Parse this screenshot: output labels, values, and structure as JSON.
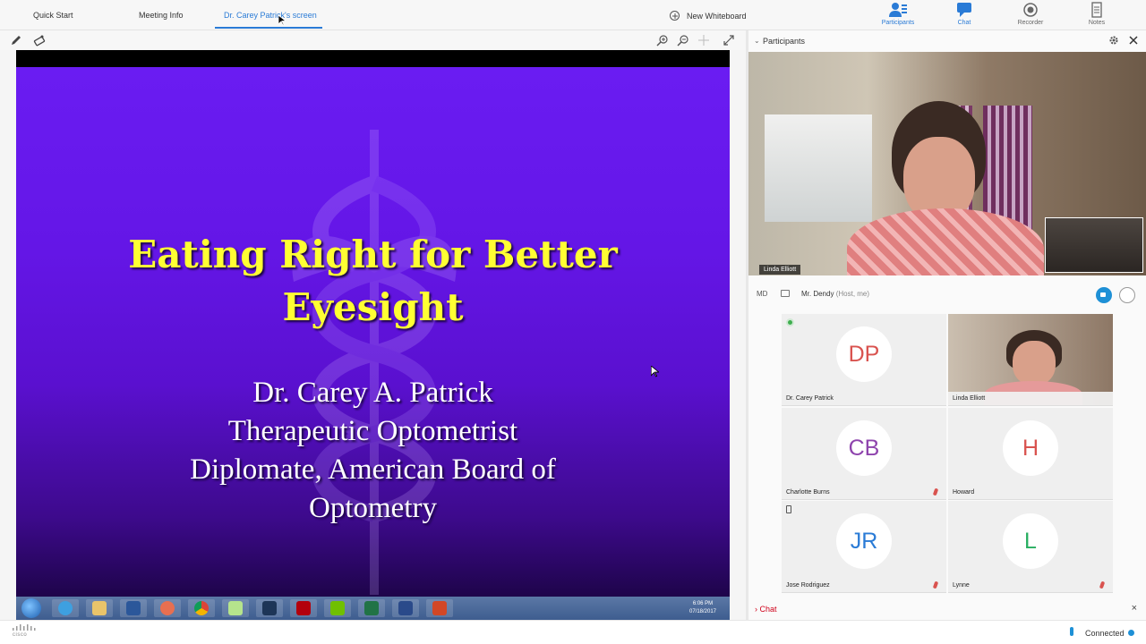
{
  "tabs": [
    {
      "label": "Quick Start"
    },
    {
      "label": "Meeting Info"
    },
    {
      "label": "Dr. Carey Patrick's screen"
    }
  ],
  "new_whiteboard": "New Whiteboard",
  "right_tools": [
    {
      "label": "Participants",
      "icon": "participants-icon",
      "active": true
    },
    {
      "label": "Chat",
      "icon": "chat-icon",
      "active": false
    },
    {
      "label": "Recorder",
      "icon": "recorder-icon",
      "active": false
    },
    {
      "label": "Notes",
      "icon": "notes-icon",
      "active": false
    }
  ],
  "slide": {
    "title_line1": "Eating Right for Better",
    "title_line2": "Eyesight",
    "sub_line1": "Dr. Carey A. Patrick",
    "sub_line2": "Therapeutic Optometrist",
    "sub_line3": "Diplomate, American Board of",
    "sub_line4": "Optometry",
    "title_color": "#ffff33",
    "background_color": "#6a1cf2"
  },
  "taskbar_clock": {
    "time": "6:06 PM",
    "date": "07/18/2017"
  },
  "participants_panel": {
    "header": "Participants",
    "active_speaker_name": "Linda Elliott",
    "self": {
      "initials": "MD",
      "name": "Mr. Dendy",
      "role": "(Host, me)"
    },
    "tiles": [
      {
        "initials": "DP",
        "name": "Dr. Carey Patrick",
        "color": "#d9534f",
        "video": false,
        "muted": false
      },
      {
        "initials": "",
        "name": "Linda Elliott",
        "color": "",
        "video": true,
        "muted": false
      },
      {
        "initials": "CB",
        "name": "Charlotte Burns",
        "color": "#8e44ad",
        "video": false,
        "muted": true
      },
      {
        "initials": "H",
        "name": "Howard",
        "color": "#d9534f",
        "video": false,
        "muted": false
      },
      {
        "initials": "JR",
        "name": "Jose Rodriguez",
        "color": "#2a7bd6",
        "video": false,
        "muted": true
      },
      {
        "initials": "L",
        "name": "Lynne",
        "color": "#27ae60",
        "video": false,
        "muted": true
      }
    ]
  },
  "chat_section": {
    "label": "Chat"
  },
  "status": {
    "connection": "Connected",
    "brand": "cisco"
  },
  "colors": {
    "accent": "#2a7bd6",
    "mute": "#d9534f"
  }
}
